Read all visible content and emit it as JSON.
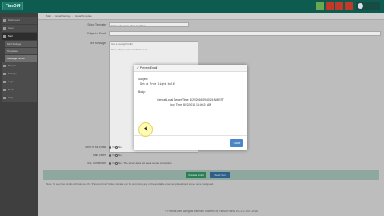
{
  "topbar": {
    "brand": "FineDiff",
    "buttons_colors": [
      "#6aa84f",
      "#c0392b",
      "#c0392b",
      "#c0392b"
    ],
    "user": ""
  },
  "breadcrumb": [
    "Mail",
    "Email Settings",
    "Email Template"
  ],
  "sidebar": {
    "items": [
      {
        "label": "Dashboard"
      },
      {
        "label": "Users"
      },
      {
        "label": "Mail",
        "active": true
      },
      {
        "label": "Reports"
      },
      {
        "label": "Settings"
      },
      {
        "label": "Logs"
      },
      {
        "label": "Tools"
      },
      {
        "label": "Help"
      }
    ],
    "sub_items": [
      {
        "label": "Mail Settings",
        "selected": false
      },
      {
        "label": "Templates",
        "selected": false
      },
      {
        "label": "Message Center",
        "selected": true
      }
    ]
  },
  "form": {
    "template_label": "Select Template",
    "template_value": "Default Template (Text and Bcc)",
    "subject_label": "Subject of Email",
    "subject_value": "",
    "body_label": "Text Message",
    "body_value_line1": "Get a free light bulb!",
    "body_value_line2": "Dear, This people-substitution text",
    "html_label": "Send HTML Email",
    "yes_label": "Yes",
    "no_label": "No",
    "plain_label": "Plain Letter",
    "ssl_label": "SSL Connection",
    "ssl_note": "No - The server does not use a secure connection"
  },
  "buttons": {
    "preview": "Preview Email",
    "test": "Send Test"
  },
  "note": "Note: To see how emails will look, use the 'Preview Email' button. Emails can be sent using any of the available email templates listed above once configured.",
  "footer": "© FineDiff.com. All rights reserved. Powered by FineDiff Portal v11.2 © 2007-2016",
  "modal": {
    "title": "Preview Email",
    "subject_label": "Subject:",
    "subject": "Get a free light bulb!",
    "body_label": "Body:",
    "line1": "Central Local Server Time: 8/22/2016 09:40:24 AM EST",
    "line2": "Your Time: 8/22/2016 13:40:24 AM",
    "close": "Close"
  }
}
